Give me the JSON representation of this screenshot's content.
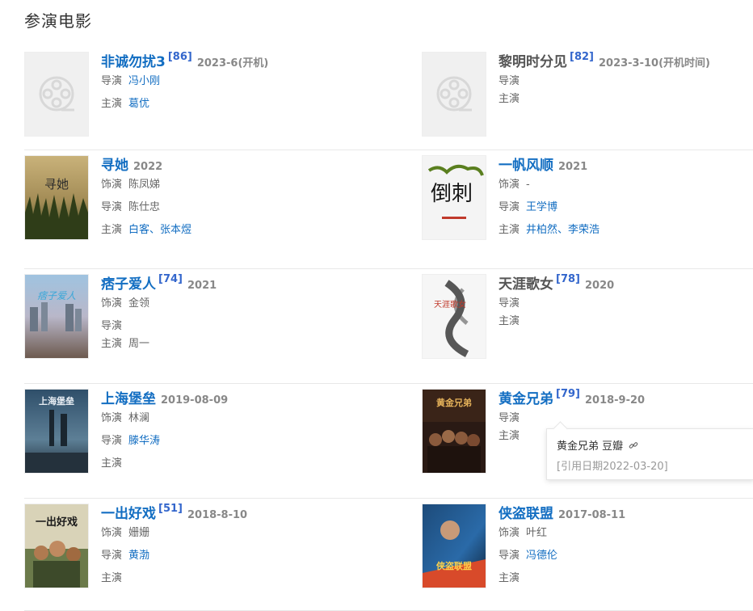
{
  "section": {
    "title": "参演电影"
  },
  "films": [
    {
      "title": "非诚勿扰3",
      "score": "[86]",
      "date": "2023-6(开机)",
      "lines": [
        {
          "label": "导演",
          "value": "冯小刚"
        },
        {
          "label": "主演",
          "value": "葛优"
        }
      ]
    },
    {
      "title": "黎明时分见",
      "score": "[82]",
      "date": "2023-3-10(开机时间)",
      "lines": [
        {
          "label": "导演",
          "value": ""
        },
        {
          "label": "主演",
          "value": ""
        }
      ]
    },
    {
      "title": "寻她",
      "score": "",
      "date": "2022",
      "lines": [
        {
          "label": "饰演",
          "value": "陈凤娣"
        },
        {
          "label": "导演",
          "value": "陈仕忠"
        },
        {
          "label": "主演",
          "value": "白客、张本煜"
        }
      ]
    },
    {
      "title": "一帆风顺",
      "score": "",
      "date": "2021",
      "lines": [
        {
          "label": "饰演",
          "value": "-"
        },
        {
          "label": "导演",
          "value": "王学博"
        },
        {
          "label": "主演",
          "value": "井柏然、李荣浩"
        }
      ]
    },
    {
      "title": "痞子爱人",
      "score": "[74]",
      "date": "2021",
      "lines": [
        {
          "label": "饰演",
          "value": "金领"
        },
        {
          "label": "导演",
          "value": ""
        },
        {
          "label": "主演",
          "value": "周一"
        }
      ]
    },
    {
      "title": "天涯歌女",
      "score": "[78]",
      "date": "2020",
      "lines": [
        {
          "label": "导演",
          "value": ""
        },
        {
          "label": "主演",
          "value": ""
        }
      ]
    },
    {
      "title": "上海堡垒",
      "score": "",
      "date": "2019-08-09",
      "lines": [
        {
          "label": "饰演",
          "value": "林澜"
        },
        {
          "label": "导演",
          "value": "滕华涛"
        },
        {
          "label": "主演",
          "value": ""
        }
      ]
    },
    {
      "title": "黄金兄弟",
      "score": "[79]",
      "date": "2018-9-20",
      "lines": [
        {
          "label": "导演",
          "value": ""
        },
        {
          "label": "主演",
          "value": ""
        }
      ]
    },
    {
      "title": "一出好戏",
      "score": "[51]",
      "date": "2018-8-10",
      "lines": [
        {
          "label": "饰演",
          "value": "姗姗"
        },
        {
          "label": "导演",
          "value": "黄渤"
        },
        {
          "label": "主演",
          "value": ""
        }
      ]
    },
    {
      "title": "侠盗联盟",
      "score": "",
      "date": "2017-08-11",
      "lines": [
        {
          "label": "饰演",
          "value": "叶红"
        },
        {
          "label": "导演",
          "value": "冯德伦"
        },
        {
          "label": "主演",
          "value": ""
        }
      ]
    }
  ],
  "tooltip": {
    "source": "黄金兄弟 豆瓣",
    "cite_date": "[引用日期2022-03-20]",
    "icon": "link-icon"
  },
  "poster_text": {
    "xunta": "寻她",
    "daoci": "倒刺",
    "pizi": "痞子爱人",
    "tianya": "天涯歌女",
    "shanghai": "上海堡垒",
    "huangjin": "黄金兄弟",
    "yichu": "一出好戏",
    "xiadao": "侠盗联盟"
  },
  "colors": {
    "link": "#136ec2",
    "score": "#3366cc",
    "muted": "#888888"
  }
}
